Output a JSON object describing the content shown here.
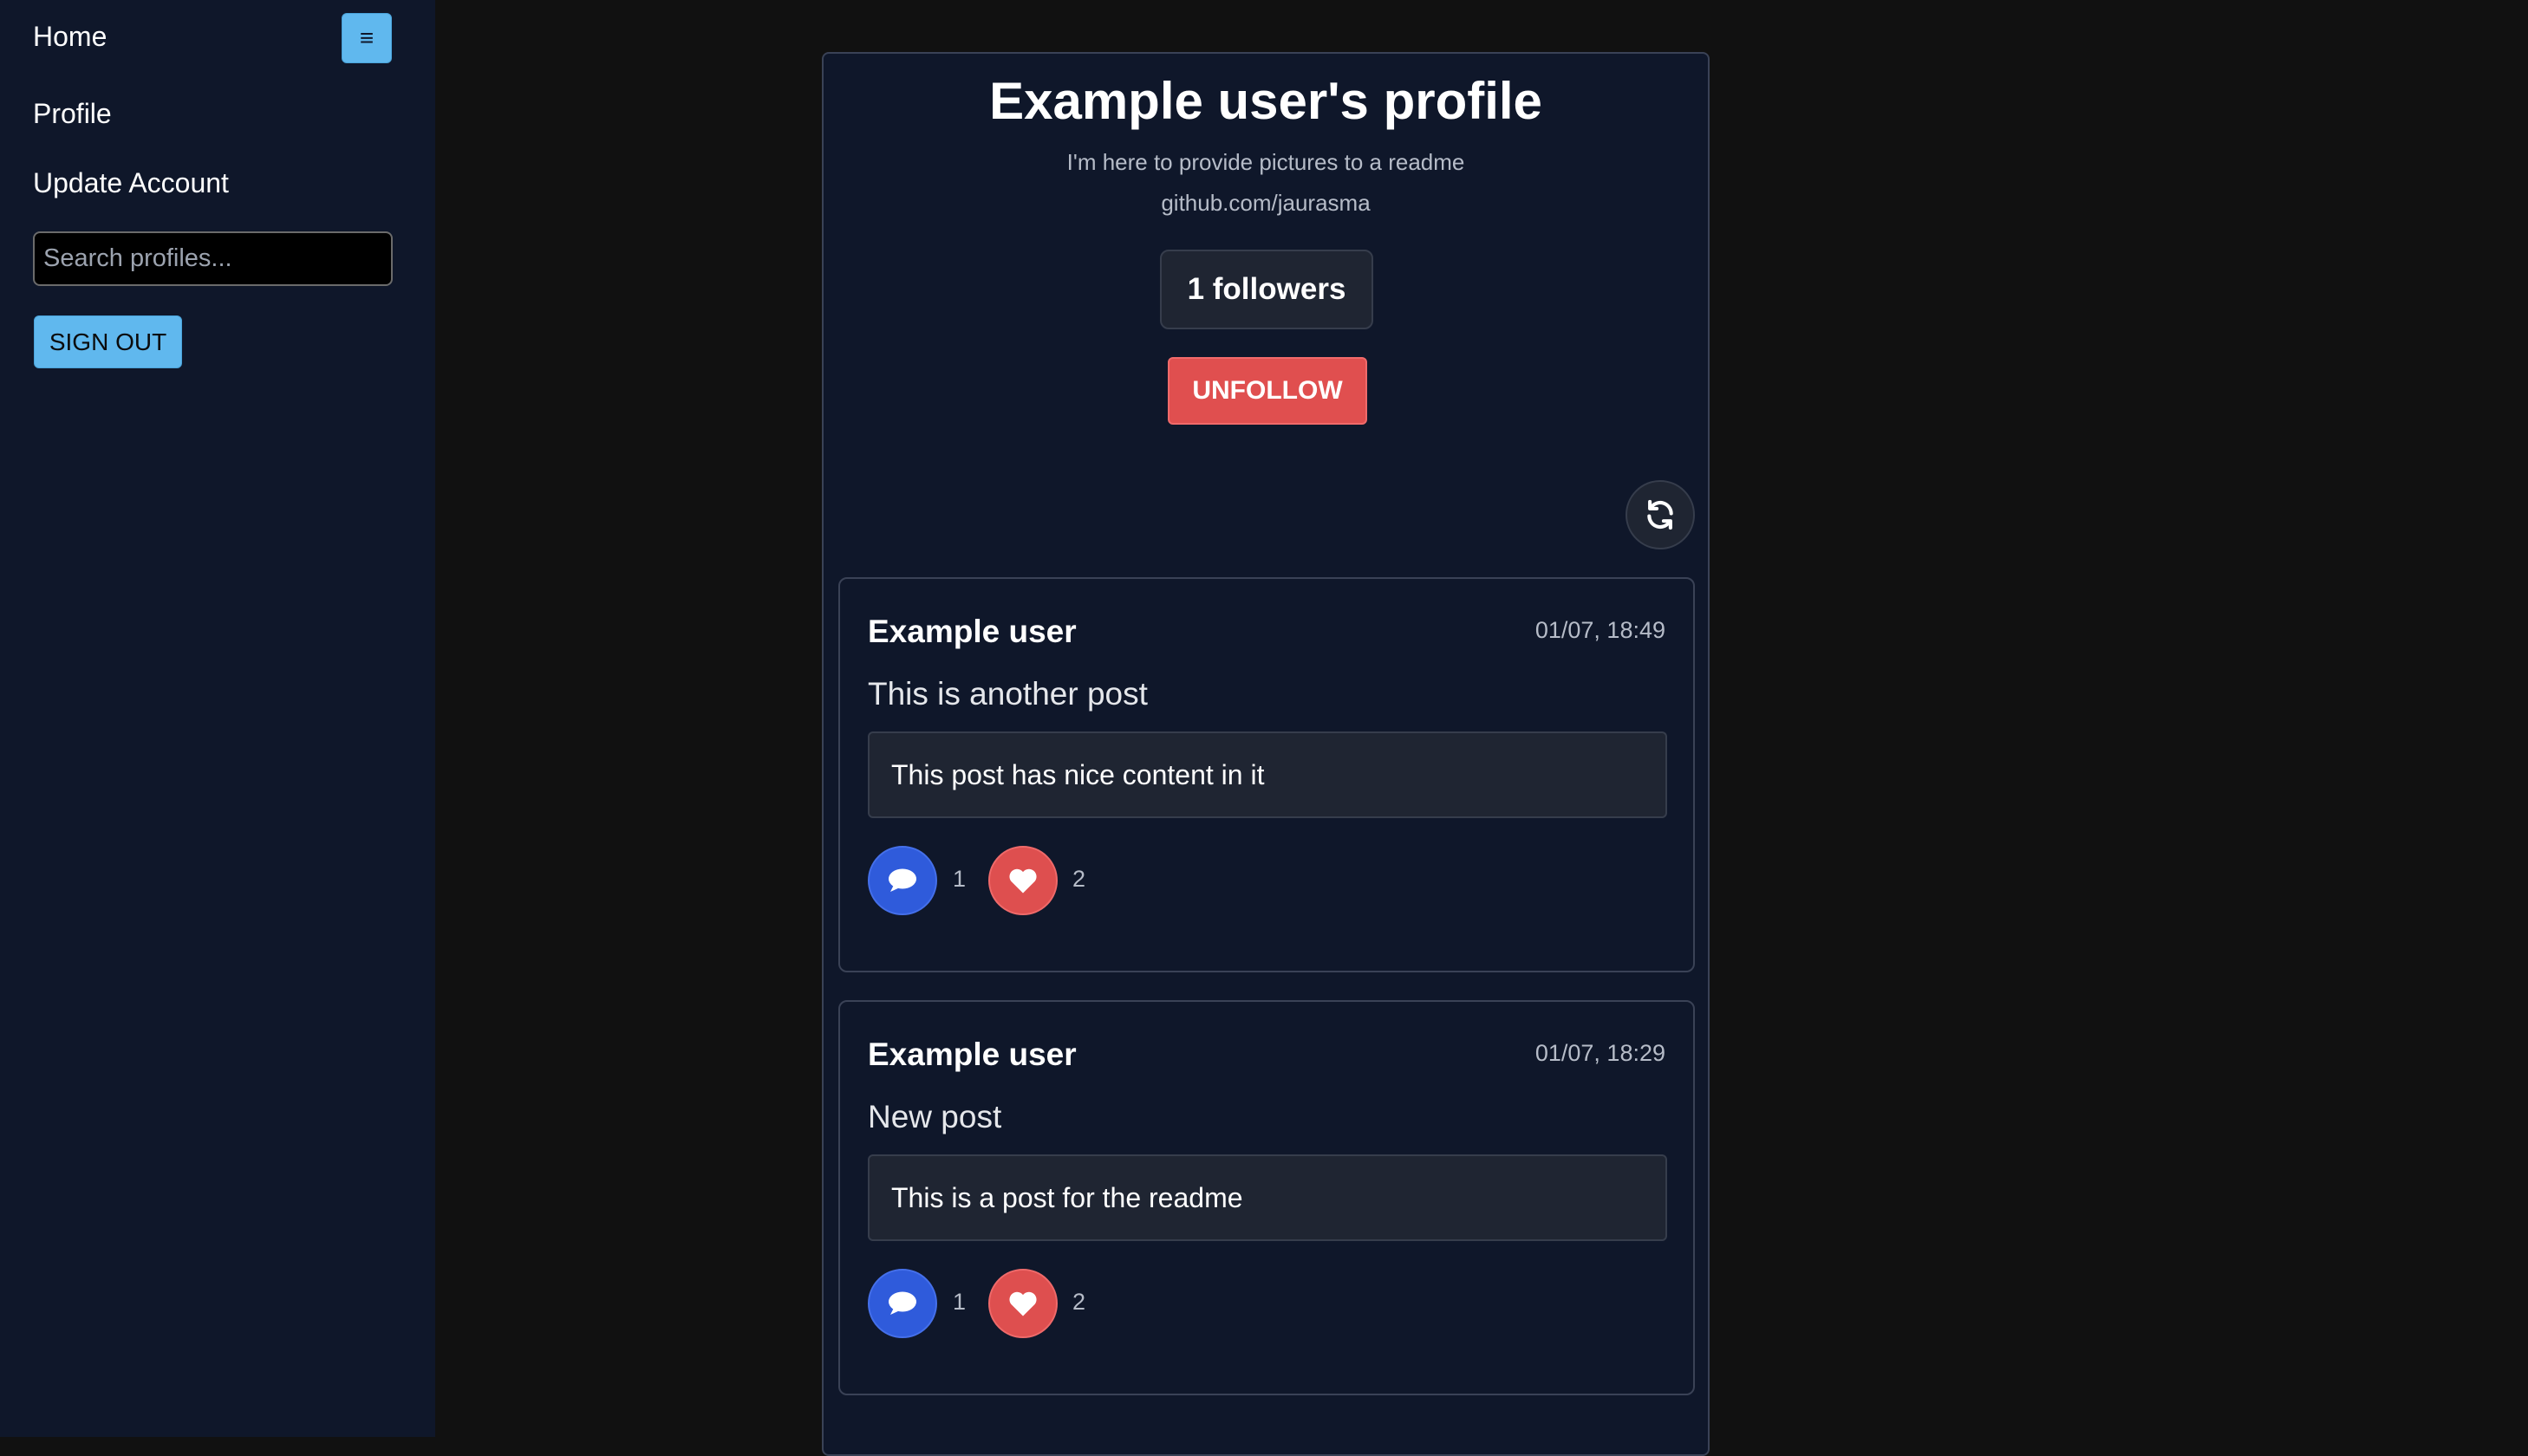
{
  "sidebar": {
    "home_label": "Home",
    "profile_label": "Profile",
    "update_account_label": "Update Account",
    "menu_icon": "≡",
    "search_placeholder": "Search profiles...",
    "sign_out_label": "SIGN OUT"
  },
  "profile": {
    "title": "Example user's profile",
    "bio": "I'm here to provide pictures to a readme",
    "link": "github.com/jaurasma",
    "followers": "1 followers",
    "unfollow_label": "UNFOLLOW"
  },
  "posts": [
    {
      "author": "Example user",
      "time": "01/07, 18:49",
      "title": "This is another post",
      "content": "This post has nice content in it",
      "comments": "1",
      "likes": "2"
    },
    {
      "author": "Example user",
      "time": "01/07, 18:29",
      "title": "New post",
      "content": "This is a post for the readme",
      "comments": "1",
      "likes": "2"
    }
  ],
  "colors": {
    "accent_blue": "#60b8ee",
    "danger_red": "#e04f4f",
    "comment_blue": "#2f5bdb",
    "panel_bg": "#0f172a"
  },
  "icons": {
    "menu": "menu-icon",
    "refresh": "refresh-icon",
    "comment": "comment-icon",
    "heart": "heart-icon"
  }
}
